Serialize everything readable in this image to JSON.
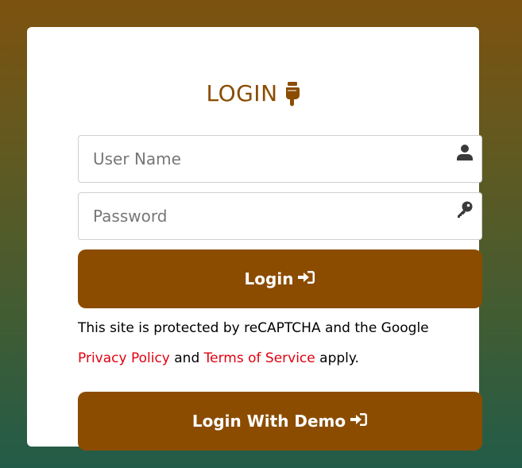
{
  "login": {
    "title": "LOGIN",
    "username_placeholder": "User Name",
    "password_placeholder": "Password",
    "login_button": "Login",
    "demo_button": "Login With Demo",
    "notice_line1": "This site is protected by reCAPTCHA and the Google",
    "privacy_link": "Privacy Policy",
    "and_text": " and ",
    "terms_link": "Terms of Service",
    "apply_text": " apply."
  },
  "colors": {
    "brand": "#8b4c00",
    "link": "#e0000f",
    "background_top": "#7d520f",
    "background_bottom": "#225c49"
  },
  "icons": {
    "title": "hand-pointing-down-icon",
    "username": "user-icon",
    "password": "key-icon",
    "login": "sign-in-icon"
  }
}
